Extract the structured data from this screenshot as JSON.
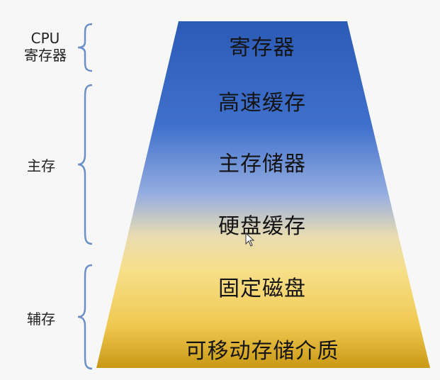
{
  "pyramid": {
    "levels": [
      {
        "label": "寄存器"
      },
      {
        "label": "高速缓存"
      },
      {
        "label": "主存储器"
      },
      {
        "label": "硬盘缓存"
      },
      {
        "label": "固定磁盘"
      },
      {
        "label": "可移动存储介质"
      }
    ],
    "colors": {
      "top": "#2f5fb8",
      "middle": "#8fa9d8",
      "lower": "#f6d77c",
      "bottom": "#d7a820"
    }
  },
  "groups": [
    {
      "label_line1": "CPU",
      "label_line2": "寄存器"
    },
    {
      "label": "主存"
    },
    {
      "label": "辅存"
    }
  ],
  "icons": {
    "brace": "curly-brace-icon",
    "cursor": "mouse-cursor-icon"
  }
}
